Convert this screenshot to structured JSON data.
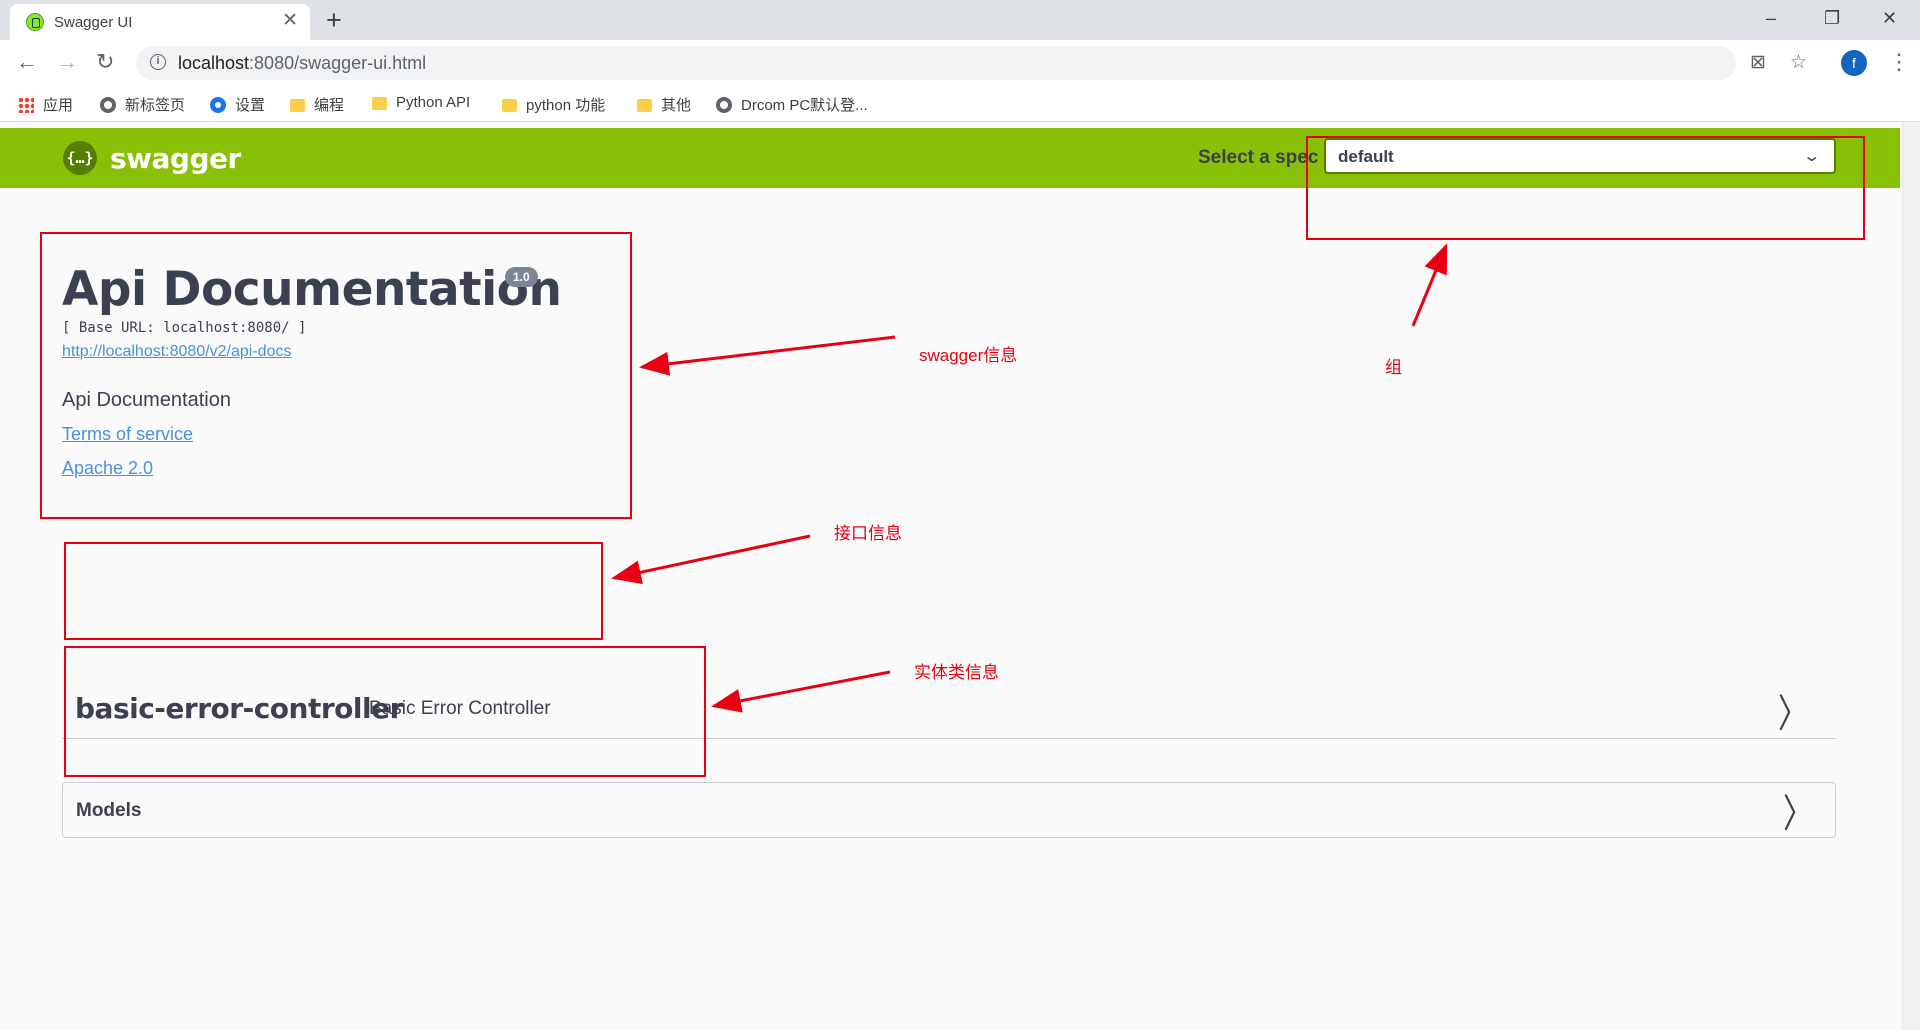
{
  "browser": {
    "tab_title": "Swagger UI",
    "tab_close": "✕",
    "new_tab": "+",
    "window_controls": [
      "–",
      "❐",
      "✕"
    ],
    "url_host": "localhost",
    "url_path": ":8080/swagger-ui.html",
    "back": "←",
    "forward": "→",
    "reload": "↻",
    "translate": "⊠",
    "star": "☆",
    "profile_initial": "f",
    "menu": "⋮"
  },
  "bookmarks": [
    {
      "label": "应用",
      "icon": "apps-icon"
    },
    {
      "label": "新标签页",
      "icon": "globe-icon"
    },
    {
      "label": "设置",
      "icon": "gear-icon"
    },
    {
      "label": "编程",
      "icon": "folder-icon"
    },
    {
      "label": "Python API",
      "icon": "folder-icon"
    },
    {
      "label": "python 功能",
      "icon": "folder-icon"
    },
    {
      "label": "其他",
      "icon": "folder-icon"
    },
    {
      "label": "Drcom PC默认登...",
      "icon": "globe-icon"
    }
  ],
  "swagger": {
    "logo_mark": "{…}",
    "logo_text": "swagger",
    "spec_label": "Select a spec",
    "spec_value": "default",
    "chevron_down": "⌄",
    "brand_color": "#89bf04"
  },
  "info": {
    "title": "Api Documentation",
    "version": "1.0",
    "base_url": "[ Base URL: localhost:8080/ ]",
    "spec_url": "http://localhost:8080/v2/api-docs",
    "description": "Api Documentation",
    "terms": "Terms of service",
    "license": "Apache 2.0"
  },
  "tags": [
    {
      "name": "basic-error-controller",
      "description": "Basic Error Controller"
    }
  ],
  "models": {
    "title": "Models"
  },
  "chevron_right": "〉",
  "annotations": {
    "swagger_info": "swagger信息",
    "group": "组",
    "api_info": "接口信息",
    "entity_info": "实体类信息",
    "color": "#e60012"
  }
}
